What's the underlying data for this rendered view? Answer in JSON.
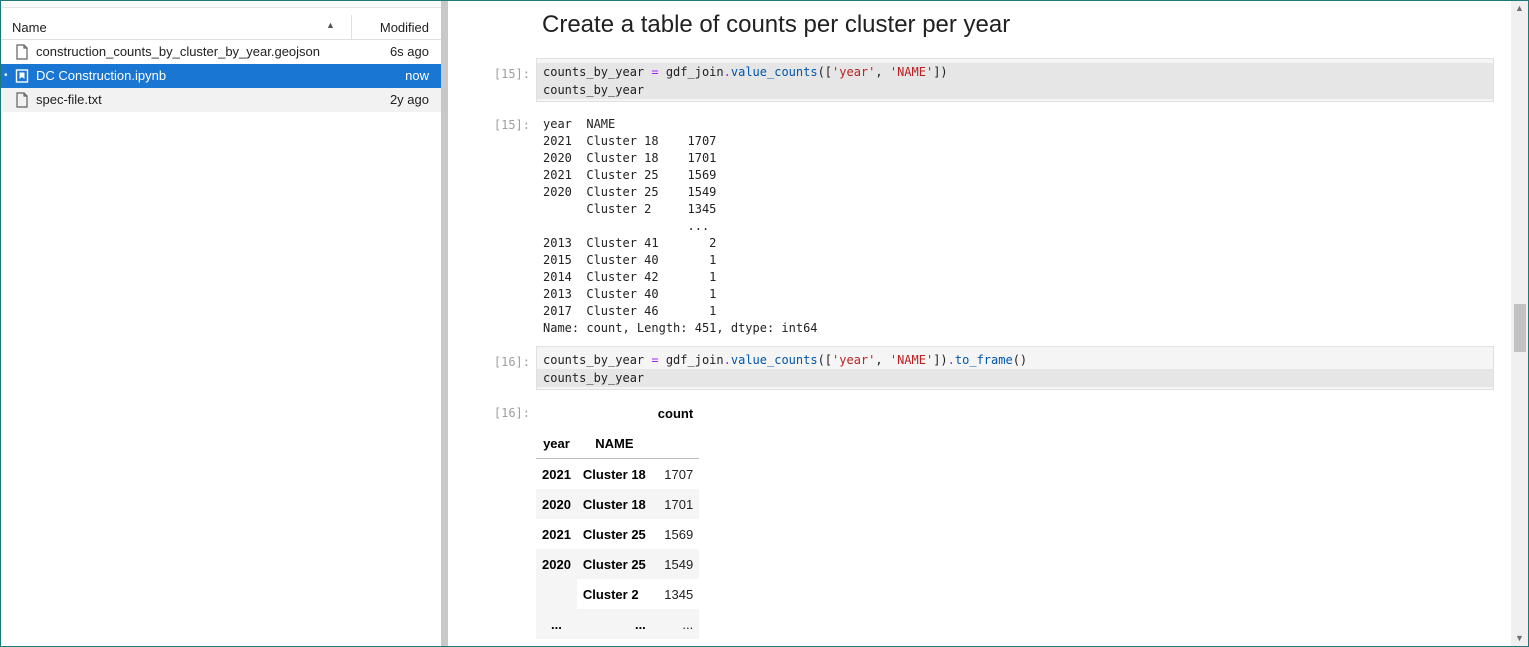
{
  "file_browser": {
    "columns": {
      "name": "Name",
      "modified": "Modified"
    },
    "sort_icon": "triangle-up",
    "files": [
      {
        "name": "construction_counts_by_cluster_by_year.geojson",
        "modified": "6s ago",
        "icon": "file-icon",
        "selected": false
      },
      {
        "name": "DC Construction.ipynb",
        "modified": "now",
        "icon": "notebook-icon",
        "selected": true,
        "running_indicator": "•"
      },
      {
        "name": "spec-file.txt",
        "modified": "2y ago",
        "icon": "file-icon",
        "selected": false
      }
    ]
  },
  "notebook": {
    "heading": "Create a table of counts per cluster per year",
    "cells": [
      {
        "prompt_in": "[15]:",
        "code": [
          "counts_by_year = gdf_join.value_counts(['year', 'NAME'])",
          "counts_by_year"
        ],
        "prompt_out": "[15]:",
        "output_lines": [
          "year  NAME",
          "2021  Cluster 18    1707",
          "2020  Cluster 18    1701",
          "2021  Cluster 25    1569",
          "2020  Cluster 25    1549",
          "      Cluster 2     1345",
          "                    ...",
          "2013  Cluster 41       2",
          "2015  Cluster 40       1",
          "2014  Cluster 42       1",
          "2013  Cluster 40       1",
          "2017  Cluster 46       1",
          "Name: count, Length: 451, dtype: int64"
        ]
      },
      {
        "prompt_in": "[16]:",
        "code": [
          "counts_by_year = gdf_join.value_counts(['year', 'NAME']).to_frame()",
          "counts_by_year"
        ],
        "prompt_out": "[16]:",
        "table": {
          "value_column": "count",
          "index_names": [
            "year",
            "NAME"
          ],
          "rows": [
            {
              "year": "2021",
              "name": "Cluster 18",
              "count": "1707"
            },
            {
              "year": "2020",
              "name": "Cluster 18",
              "count": "1701"
            },
            {
              "year": "2021",
              "name": "Cluster 25",
              "count": "1569"
            },
            {
              "year": "2020",
              "name": "Cluster 25",
              "count": "1549"
            },
            {
              "year": "",
              "name": "Cluster 2",
              "count": "1345"
            },
            {
              "year": "...",
              "name": "...",
              "count": "..."
            }
          ]
        }
      }
    ]
  }
}
